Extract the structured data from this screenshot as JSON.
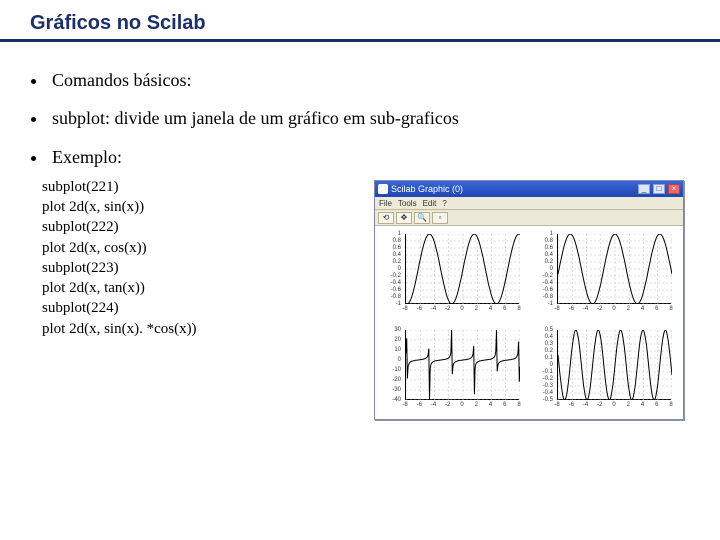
{
  "title": "Gráficos no Scilab",
  "bullets": [
    "Comandos básicos:",
    "subplot: divide um janela de um gráfico em sub-graficos",
    "Exemplo:"
  ],
  "code_lines": [
    "subplot(221)",
    "plot 2d(x, sin(x))",
    "subplot(222)",
    "plot 2d(x, cos(x))",
    "subplot(223)",
    "plot 2d(x, tan(x))",
    "subplot(224)",
    "plot 2d(x, sin(x). *cos(x))"
  ],
  "window": {
    "title": "Scilab Graphic (0)",
    "menus": [
      "File",
      "Tools",
      "Edit",
      "?"
    ],
    "toolbar_icons": [
      "rotate-icon",
      "arrows-icon",
      "zoom-icon",
      "zoom-out-icon"
    ]
  },
  "chart_data": [
    {
      "type": "line",
      "title": "",
      "xlabel": "",
      "ylabel": "",
      "x_ticks": [
        -8,
        -6,
        -4,
        -2,
        0,
        2,
        4,
        6,
        8
      ],
      "y_ticks": [
        -1.0,
        -0.8,
        -0.6,
        -0.4,
        -0.2,
        0.0,
        0.2,
        0.4,
        0.6,
        0.8,
        1.0
      ],
      "xlim": [
        -8,
        8
      ],
      "ylim": [
        -1,
        1
      ],
      "series": [
        {
          "name": "sin(x)",
          "expr": "sin(x)"
        }
      ]
    },
    {
      "type": "line",
      "xlabel": "",
      "ylabel": "",
      "x_ticks": [
        -8,
        -6,
        -4,
        -2,
        0,
        2,
        4,
        6,
        8
      ],
      "y_ticks": [
        -1.0,
        -0.8,
        -0.6,
        -0.4,
        -0.2,
        0.0,
        0.2,
        0.4,
        0.6,
        0.8,
        1.0
      ],
      "xlim": [
        -8,
        8
      ],
      "ylim": [
        -1,
        1
      ],
      "series": [
        {
          "name": "cos(x)",
          "expr": "cos(x)"
        }
      ]
    },
    {
      "type": "line",
      "xlabel": "",
      "ylabel": "",
      "x_ticks": [
        -8,
        -6,
        -4,
        -2,
        0,
        2,
        4,
        6,
        8
      ],
      "y_ticks": [
        -40,
        -30,
        -20,
        -10,
        0,
        10,
        20,
        30
      ],
      "xlim": [
        -8,
        8
      ],
      "ylim": [
        -40,
        30
      ],
      "series": [
        {
          "name": "tan(x)",
          "expr": "tan(x)"
        }
      ]
    },
    {
      "type": "line",
      "xlabel": "",
      "ylabel": "",
      "x_ticks": [
        -8,
        -6,
        -4,
        -2,
        0,
        2,
        4,
        6,
        8
      ],
      "y_ticks": [
        -0.5,
        -0.4,
        -0.3,
        -0.2,
        -0.1,
        0.0,
        0.1,
        0.2,
        0.3,
        0.4,
        0.5
      ],
      "xlim": [
        -8,
        8
      ],
      "ylim": [
        -0.5,
        0.5
      ],
      "series": [
        {
          "name": "sin(x)*cos(x)",
          "expr": "sin(x)*cos(x)"
        }
      ]
    }
  ]
}
